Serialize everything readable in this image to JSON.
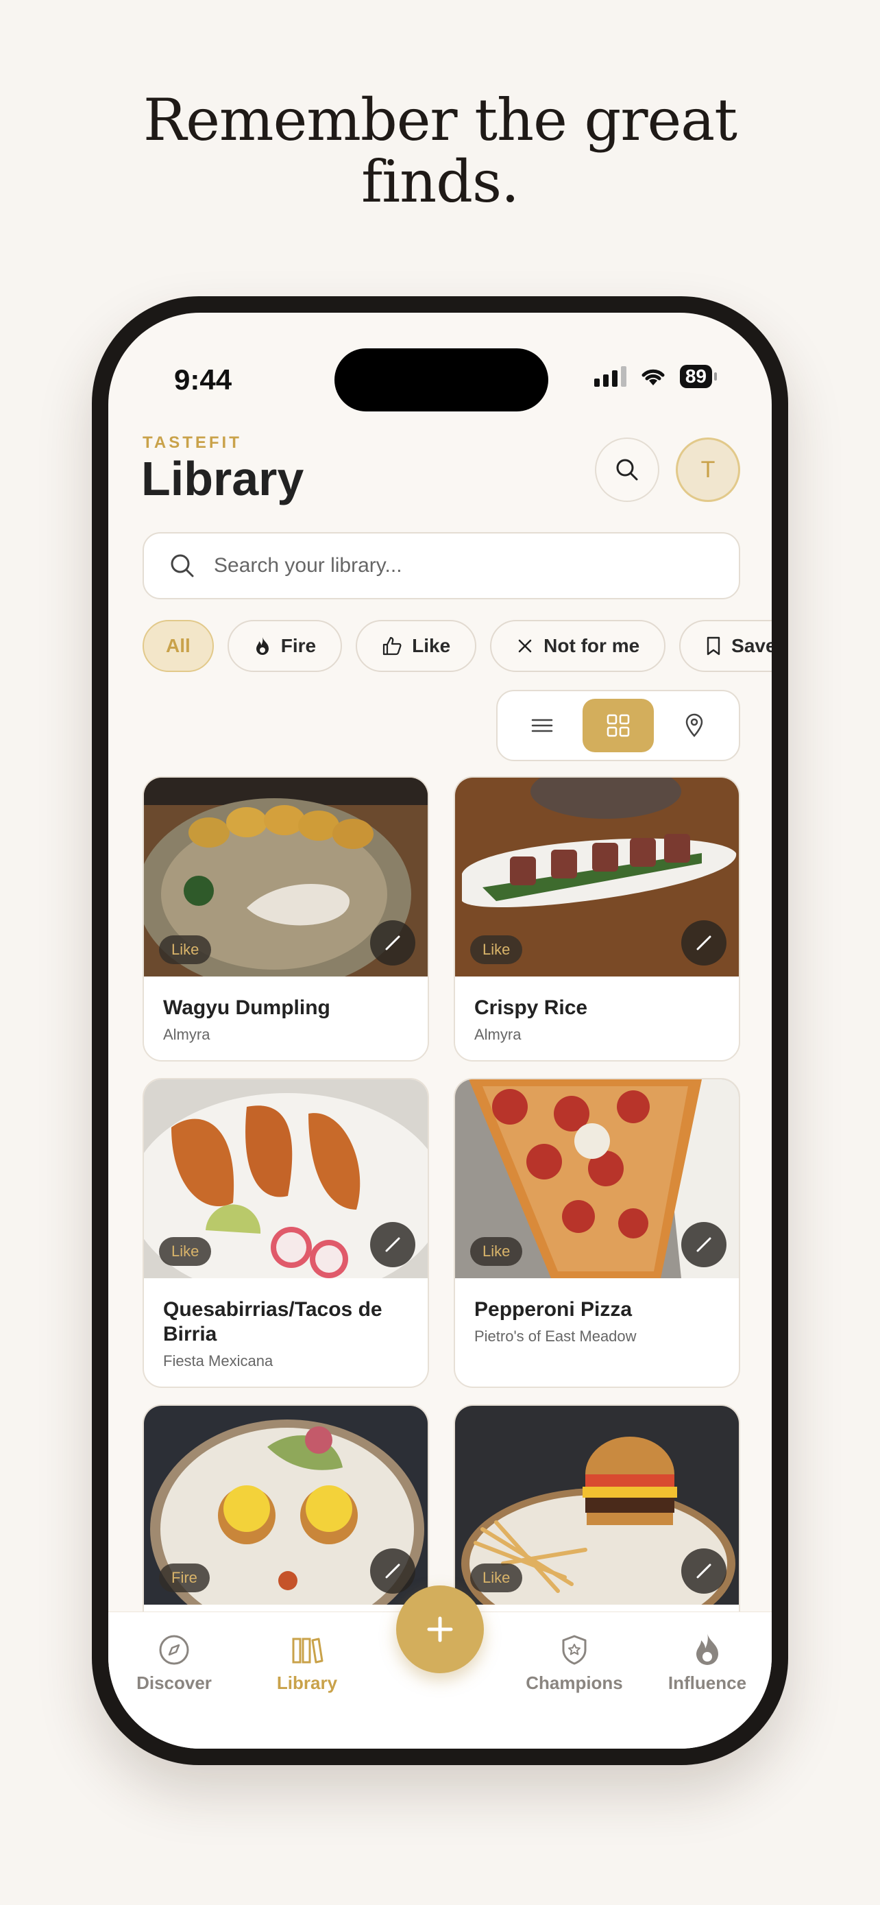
{
  "headline": {
    "line1": "Remember the great",
    "line2": "finds."
  },
  "status": {
    "time": "9:44",
    "battery": "89"
  },
  "header": {
    "brand": "TASTEFIT",
    "title": "Library",
    "avatar_initial": "T"
  },
  "search": {
    "placeholder": "Search your library..."
  },
  "filters": [
    {
      "label": "All",
      "icon": "none",
      "active": true
    },
    {
      "label": "Fire",
      "icon": "flame-icon"
    },
    {
      "label": "Like",
      "icon": "thumbs-up-icon"
    },
    {
      "label": "Not for me",
      "icon": "x-icon"
    },
    {
      "label": "Saved",
      "icon": "bookmark-icon"
    }
  ],
  "view_modes": [
    {
      "name": "list",
      "icon": "list-icon"
    },
    {
      "name": "grid",
      "icon": "grid-icon",
      "active": true
    },
    {
      "name": "map",
      "icon": "map-pin-icon"
    }
  ],
  "items": [
    {
      "name": "Wagyu Dumpling",
      "place": "Almyra",
      "rating": "Like"
    },
    {
      "name": "Crispy Rice",
      "place": "Almyra",
      "rating": "Like"
    },
    {
      "name": "Quesabirrias/Tacos de Birria",
      "place": "Fiesta Mexicana",
      "rating": "Like"
    },
    {
      "name": "Pepperoni Pizza",
      "place": "Pietro's of East Meadow",
      "rating": "Like"
    },
    {
      "name": "",
      "place": "",
      "rating": "Fire"
    },
    {
      "name": "",
      "place": "",
      "rating": "Like"
    }
  ],
  "tabs": [
    {
      "label": "Discover",
      "icon": "compass-icon"
    },
    {
      "label": "Library",
      "icon": "library-icon",
      "active": true
    },
    {
      "label": "Champions",
      "icon": "shield-star-icon"
    },
    {
      "label": "Influence",
      "icon": "flame-icon"
    }
  ],
  "colors": {
    "accent": "#d3ae5c",
    "background": "#faf7f3",
    "text": "#222222"
  }
}
